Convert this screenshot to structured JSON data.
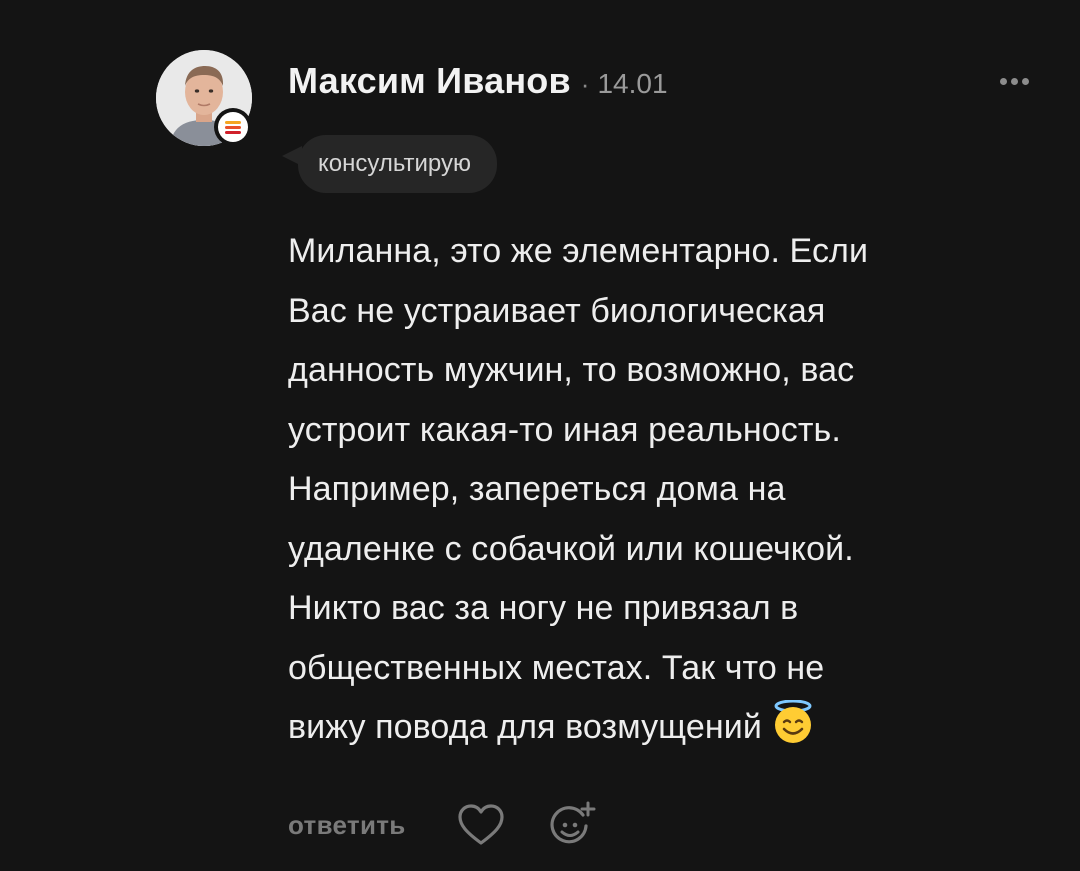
{
  "comment": {
    "author_name": "Максим Иванов",
    "separator": "·",
    "date": "14.01",
    "badge": "консультирую",
    "text_lines": [
      "Миланна, это же элементарно. Если",
      "Вас не устраивает биологическая",
      "данность мужчин, то возможно, вас",
      "устроит какая-то иная реальность.",
      "Например, запереться дома на",
      "удаленке с собачкой или кошечкой.",
      "Никто вас за ногу не привязал в",
      "общественных местах. Так что не",
      "вижу повода для возмущений"
    ],
    "trailing_emoji": "smiling-face-with-halo-icon"
  },
  "actions": {
    "reply_label": "ответить",
    "like_icon": "heart-icon",
    "react_icon": "add-reaction-icon"
  },
  "menu": {
    "more_icon": "more-dots-icon"
  },
  "colors": {
    "background": "#141414",
    "text": "#eeeeee",
    "muted": "#7a7a7a",
    "badge_bg": "#262626",
    "status_stripes": [
      "#f5a623",
      "#e8502a",
      "#d0202a"
    ]
  }
}
